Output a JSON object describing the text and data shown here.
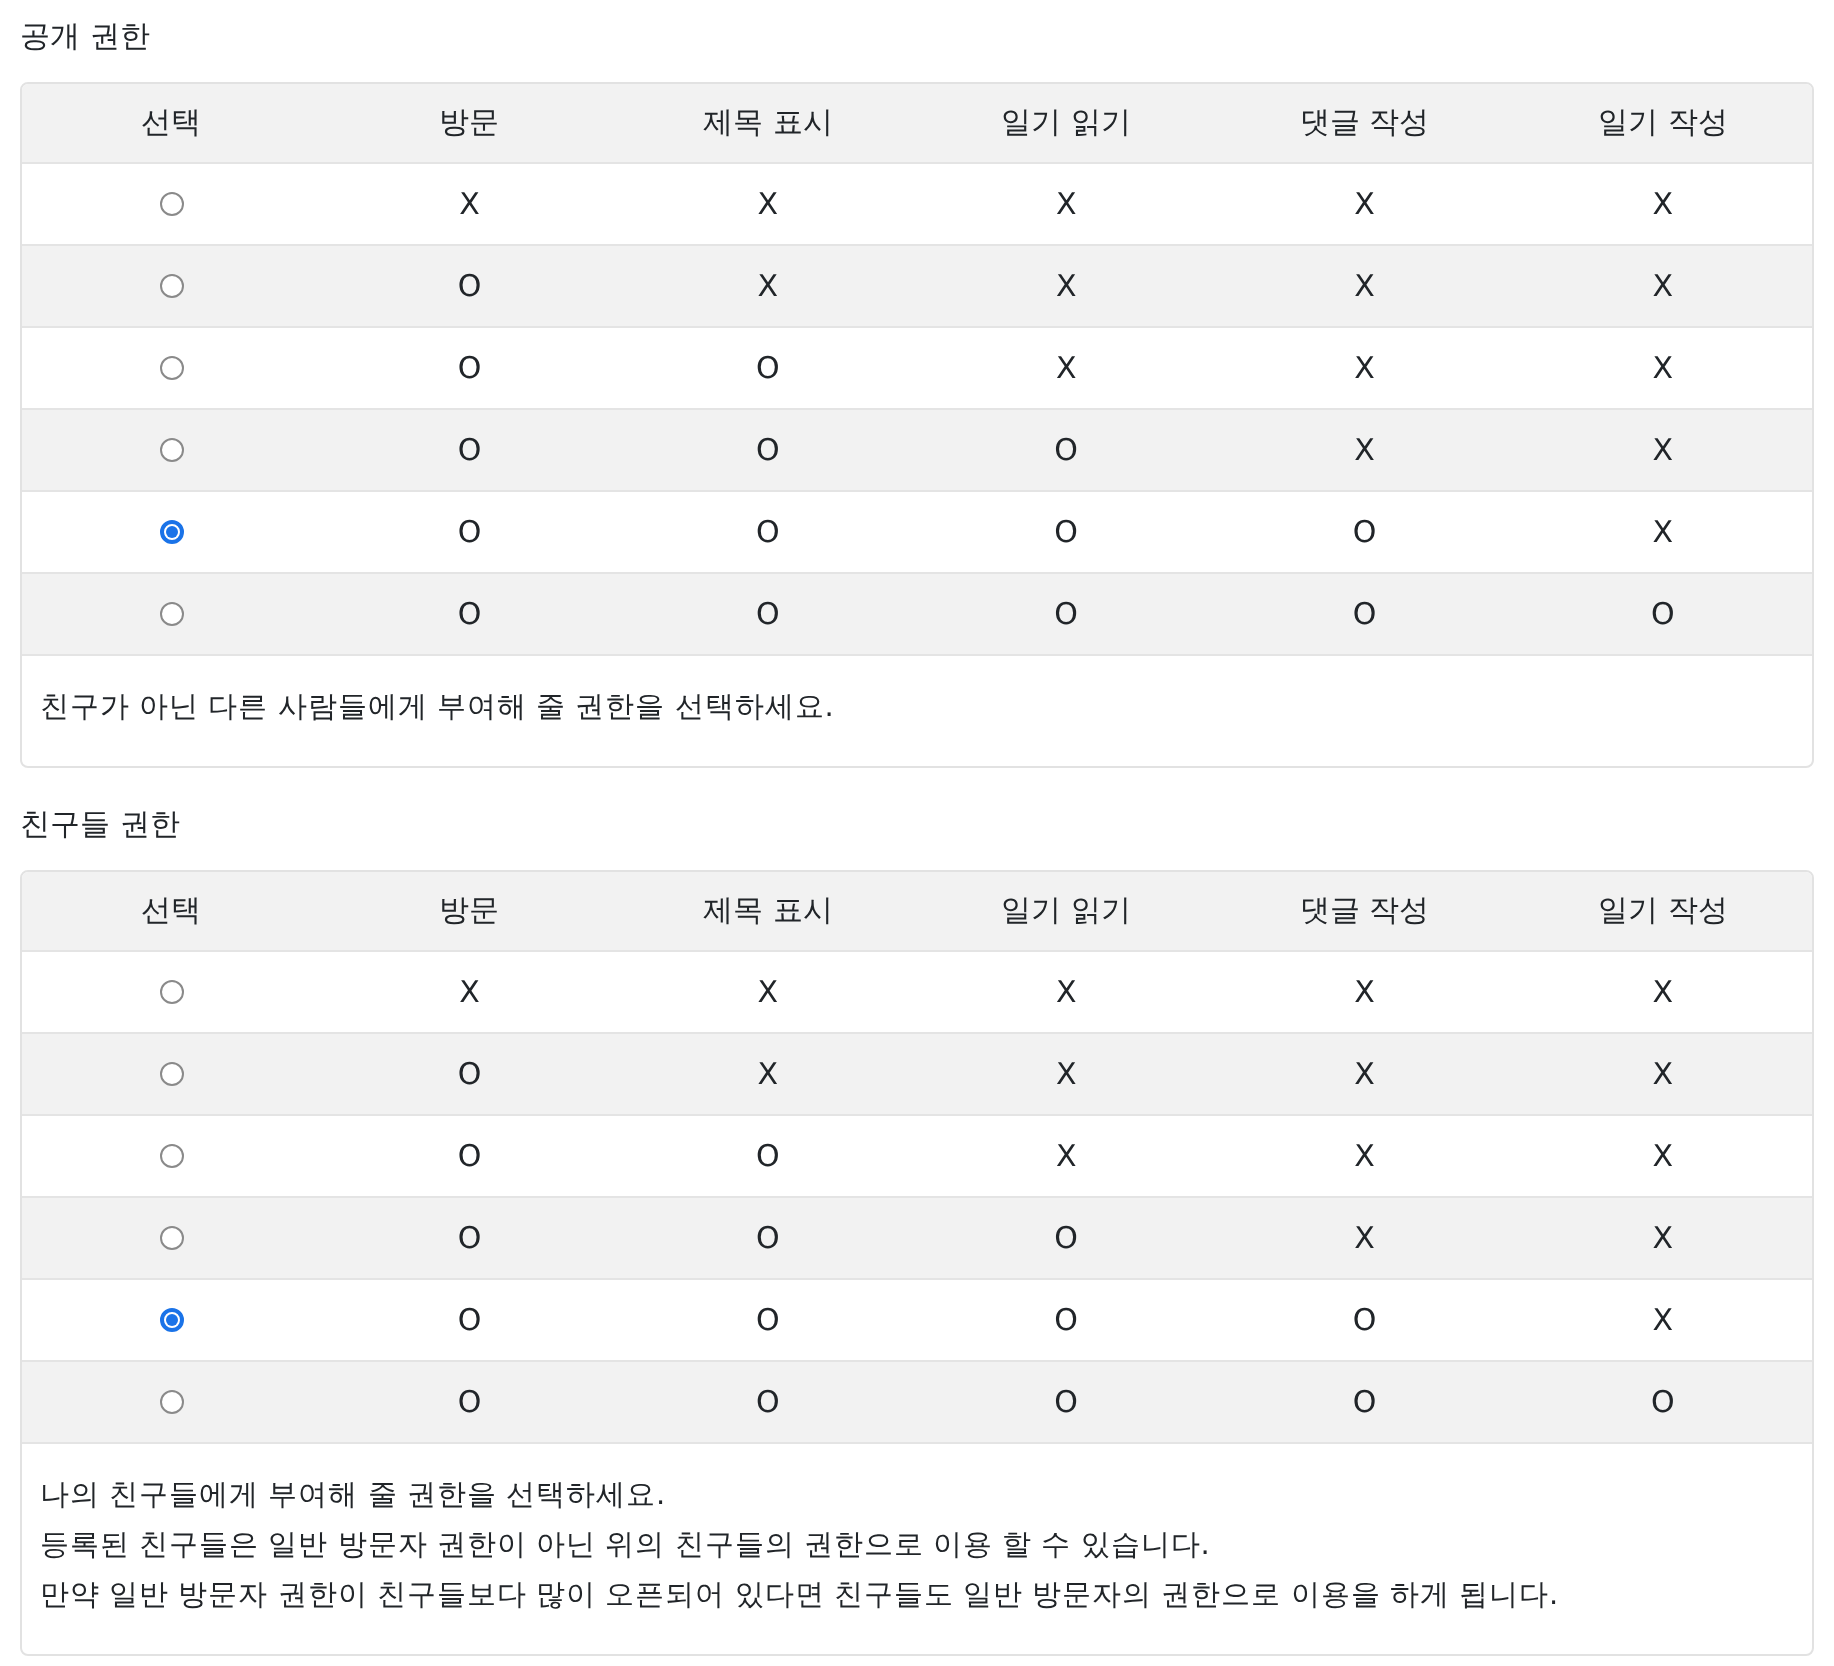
{
  "sections": [
    {
      "title": "공개 권한",
      "columns": [
        "선택",
        "방문",
        "제목 표시",
        "일기 읽기",
        "댓글 작성",
        "일기 작성"
      ],
      "rows": [
        {
          "cells": [
            {
              "kind": "radio",
              "selected": false
            },
            "X",
            "X",
            "X",
            "X",
            "X"
          ]
        },
        {
          "cells": [
            {
              "kind": "radio",
              "selected": false
            },
            "O",
            "X",
            "X",
            "X",
            "X"
          ]
        },
        {
          "cells": [
            {
              "kind": "radio",
              "selected": false
            },
            "O",
            "O",
            "X",
            "X",
            "X"
          ]
        },
        {
          "cells": [
            {
              "kind": "radio",
              "selected": false
            },
            "O",
            "O",
            "O",
            "X",
            "X"
          ]
        },
        {
          "cells": [
            {
              "kind": "radio",
              "selected": true
            },
            "O",
            "O",
            "O",
            "O",
            "X"
          ]
        },
        {
          "cells": [
            {
              "kind": "radio",
              "selected": false
            },
            "O",
            "O",
            "O",
            "O",
            "O"
          ]
        }
      ],
      "notes": [
        "친구가 아닌 다른 사람들에게 부여해 줄 권한을 선택하세요."
      ]
    },
    {
      "title": "친구들 권한",
      "columns": [
        "선택",
        "방문",
        "제목 표시",
        "일기 읽기",
        "댓글 작성",
        "일기 작성"
      ],
      "rows": [
        {
          "cells": [
            {
              "kind": "radio",
              "selected": false
            },
            "X",
            "X",
            "X",
            "X",
            "X"
          ]
        },
        {
          "cells": [
            {
              "kind": "radio",
              "selected": false
            },
            "O",
            "X",
            "X",
            "X",
            "X"
          ]
        },
        {
          "cells": [
            {
              "kind": "radio",
              "selected": false
            },
            "O",
            "O",
            "X",
            "X",
            "X"
          ]
        },
        {
          "cells": [
            {
              "kind": "radio",
              "selected": false
            },
            "O",
            "O",
            "O",
            "X",
            "X"
          ]
        },
        {
          "cells": [
            {
              "kind": "radio",
              "selected": true
            },
            "O",
            "O",
            "O",
            "O",
            "X"
          ]
        },
        {
          "cells": [
            {
              "kind": "radio",
              "selected": false
            },
            "O",
            "O",
            "O",
            "O",
            "O"
          ]
        }
      ],
      "notes": [
        "나의 친구들에게 부여해 줄 권한을 선택하세요.",
        "등록된 친구들은 일반 방문자 권한이 아닌 위의 친구들의 권한으로 이용 할 수 있습니다.",
        "만약 일반 방문자 권한이 친구들보다 많이 오픈되어 있다면 친구들도 일반 방문자의 권한으로 이용을 하게 됩니다."
      ]
    }
  ]
}
